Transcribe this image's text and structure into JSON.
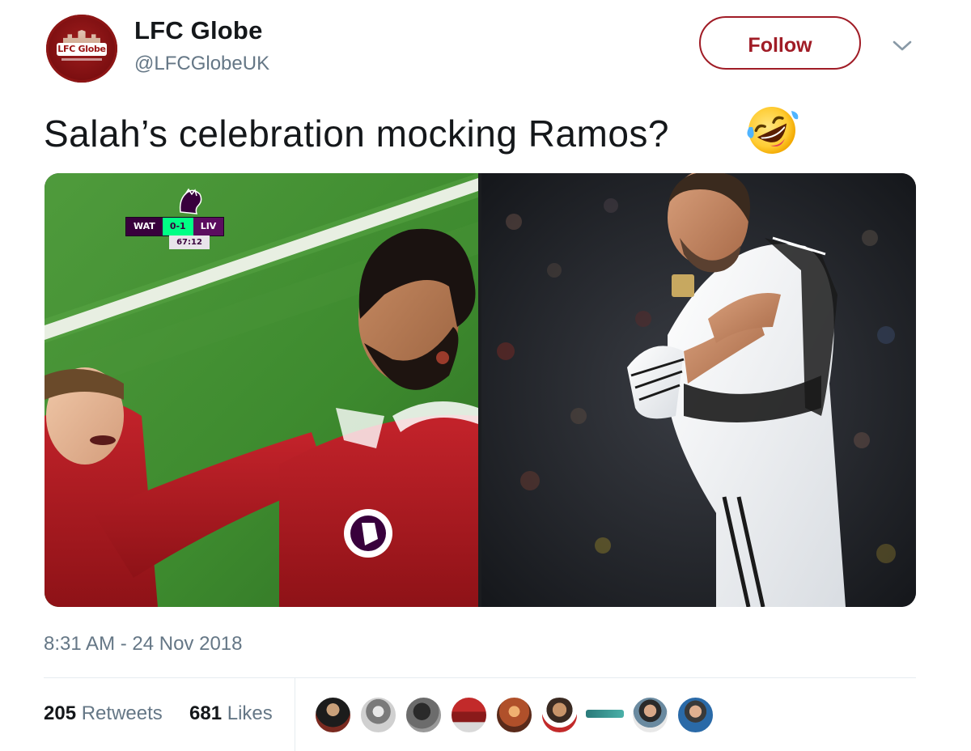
{
  "account": {
    "name": "LFC Globe",
    "handle": "@LFCGlobeUK",
    "avatar_text": "LFC Globe"
  },
  "follow_button": {
    "label": "Follow"
  },
  "menu": {
    "icon": "chevron-down-icon"
  },
  "tweet": {
    "text": "Salah’s celebration mocking Ramos?",
    "emoji": "rolling-on-floor-laughing"
  },
  "media": {
    "left": {
      "scoreboard": {
        "home": "WAT",
        "score": "0-1",
        "away": "LIV",
        "clock": "67:12"
      }
    },
    "right": {}
  },
  "timestamp": "8:31 AM - 24 Nov 2018",
  "stats": {
    "retweets_count": "205",
    "retweets_label": "Retweets",
    "likes_count": "681",
    "likes_label": "Likes"
  },
  "likers": [
    "liker-1",
    "liker-2",
    "liker-3",
    "liker-4",
    "liker-5",
    "liker-6",
    "liker-7",
    "liker-8",
    "liker-9"
  ],
  "colors": {
    "accent": "#a01c26",
    "text_primary": "#14171a",
    "text_secondary": "#657786",
    "divider": "#e6ecf0"
  }
}
